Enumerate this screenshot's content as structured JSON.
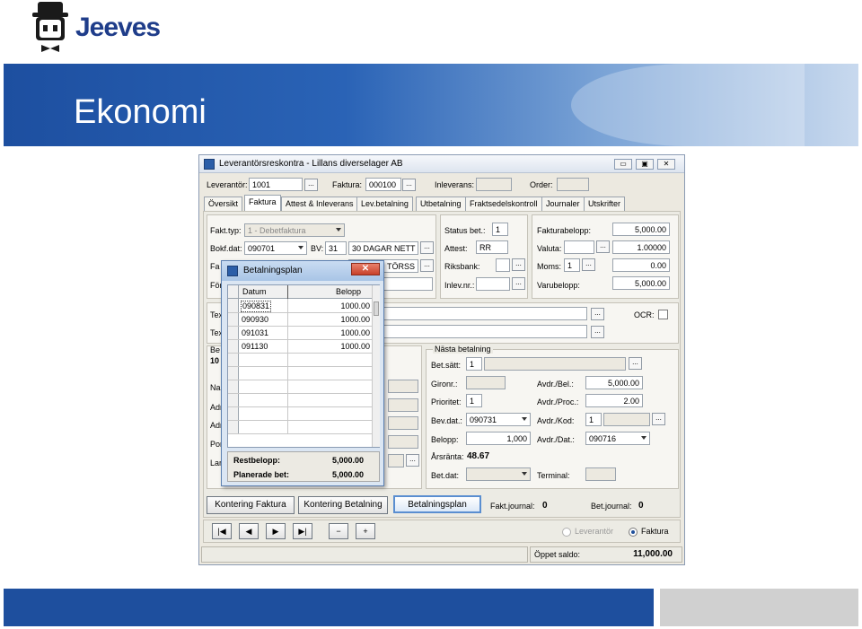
{
  "slide": {
    "brand": "Jeeves",
    "title": "Ekonomi"
  },
  "window": {
    "title": "Leverantörsreskontra - Lillans diverselager AB",
    "controls": {
      "minimize": "▭",
      "maximize": "▣",
      "close": "✕"
    }
  },
  "header": {
    "leverantor_label": "Leverantör:",
    "leverantor_value": "1001",
    "faktura_label": "Faktura:",
    "faktura_value": "000100",
    "inleverans_label": "Inleverans:",
    "order_label": "Order:",
    "dots": "..."
  },
  "tabs": [
    "Översikt",
    "Faktura",
    "Attest & Inleverans",
    "Lev.betalning",
    "Utbetalning",
    "Fraktsedelskontroll",
    "Journaler",
    "Utskrifter"
  ],
  "faktura": {
    "fakt_typ_label": "Fakt.typ:",
    "fakt_typ_value": "1 - Debetfaktura",
    "bokf_dat_label": "Bokf.dat:",
    "bokf_dat_value": "090701",
    "bv_label": "BV:",
    "bv_value": "31",
    "bv_text": "30 DAGAR NETT",
    "row3_label_partial": "Fa",
    "row3_text_partial": "TÖRSS",
    "row4_label_partial": "För"
  },
  "status": {
    "status_bet_label": "Status bet.:",
    "status_bet_value": "1",
    "attest_label": "Attest:",
    "attest_value": "RR",
    "riksbank_label": "Riksbank:",
    "inlev_nr_label": "Inlev.nr.:"
  },
  "amounts": {
    "fakturabelopp_label": "Fakturabelopp:",
    "fakturabelopp_value": "5,000.00",
    "valuta_label": "Valuta:",
    "valuta_rate": "1.00000",
    "moms_label": "Moms:",
    "moms_code": "1",
    "moms_value": "0.00",
    "varubelopp_label": "Varubelopp:",
    "varubelopp_value": "5,000.00"
  },
  "text_rows": {
    "tex1": "Tex",
    "tex2": "Tex",
    "ocr_label": "OCR:"
  },
  "left_partial": {
    "be": "Be",
    "ten": "10",
    "na": "Na",
    "adr1": "Adr",
    "adr2": "Adr",
    "po": "Por",
    "la": "Lar"
  },
  "nasta_betalning": {
    "title": "Nästa betalning",
    "bet_satt_label": "Bet.sätt:",
    "bet_satt_value": "1",
    "gironr_label": "Gironr.:",
    "prioritet_label": "Prioritet:",
    "prioritet_value": "1",
    "bev_dat_label": "Bev.dat.:",
    "bev_dat_value": "090731",
    "belopp_label": "Belopp:",
    "belopp_value": "1,000",
    "arsranta_label": "Årsränta:",
    "arsranta_value": "48.67",
    "bet_dat_label": "Bet.dat:",
    "avdr_bel_label": "Avdr./Bel.:",
    "avdr_bel_value": "5,000.00",
    "avdr_proc_label": "Avdr./Proc.:",
    "avdr_proc_value": "2.00",
    "avdr_kod_label": "Avdr./Kod:",
    "avdr_kod_value": "1",
    "avdr_dat_label": "Avdr./Dat.:",
    "avdr_dat_value": "090716",
    "terminal_label": "Terminal:"
  },
  "bottom": {
    "kontering_faktura": "Kontering Faktura",
    "kontering_betalning": "Kontering Betalning",
    "betalningsplan": "Betalningsplan",
    "fakt_journal_label": "Fakt.journal:",
    "fakt_journal_value": "0",
    "bet_journal_label": "Bet.journal:",
    "bet_journal_value": "0",
    "radio_leverantor": "Leverantör",
    "radio_faktura": "Faktura",
    "oppet_saldo_label": "Öppet saldo:",
    "oppet_saldo_value": "11,000.00",
    "nav": [
      "|◀",
      "◀",
      "▶",
      "▶|",
      "−",
      "+"
    ]
  },
  "dialog": {
    "title": "Betalningsplan",
    "close": "✕",
    "columns": [
      "Datum",
      "Belopp"
    ],
    "rows": [
      {
        "datum": "090831",
        "belopp": "1000.00"
      },
      {
        "datum": "090930",
        "belopp": "1000.00"
      },
      {
        "datum": "091031",
        "belopp": "1000.00"
      },
      {
        "datum": "091130",
        "belopp": "1000.00"
      }
    ],
    "restbelopp_label": "Restbelopp:",
    "restbelopp_value": "5,000.00",
    "planerade_label": "Planerade bet:",
    "planerade_value": "5,000.00"
  }
}
